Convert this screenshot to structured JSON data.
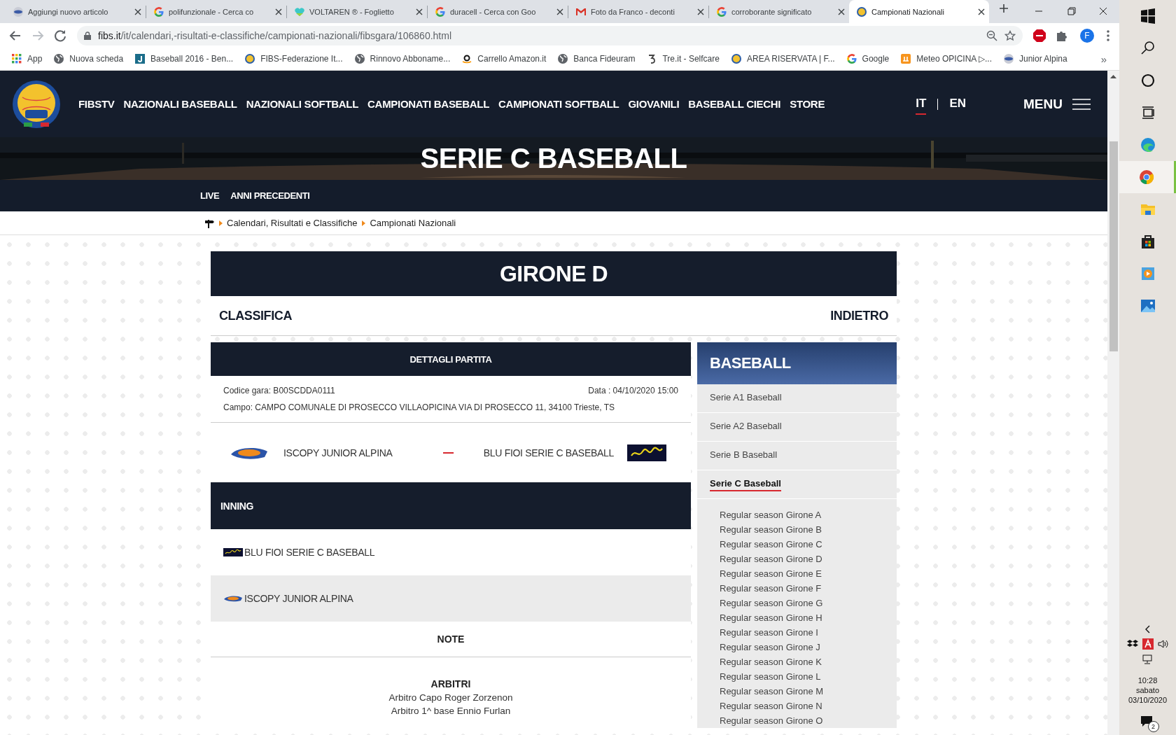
{
  "browser": {
    "tabs": [
      {
        "title": "Aggiungi nuovo articolo",
        "selected": false
      },
      {
        "title": "polifunzionale - Cerca co",
        "selected": false
      },
      {
        "title": "VOLTAREN ® - Foglietto",
        "selected": false
      },
      {
        "title": "duracell - Cerca con Goo",
        "selected": false
      },
      {
        "title": "Foto da Franco - deconti",
        "selected": false
      },
      {
        "title": "corroborante significato",
        "selected": false
      },
      {
        "title": "Campionati Nazionali",
        "selected": true
      }
    ],
    "address": {
      "domain": "fibs.it",
      "path": "/it/calendari,-risultati-e-classifiche/campionati-nazionali/fibsgara/106860.html"
    },
    "profile": "F",
    "bookmarks": [
      {
        "label": "App"
      },
      {
        "label": "Nuova scheda"
      },
      {
        "label": "Baseball 2016 - Ben..."
      },
      {
        "label": "FIBS-Federazione It..."
      },
      {
        "label": "Rinnovo Abboname..."
      },
      {
        "label": "Carrello Amazon.it"
      },
      {
        "label": "Banca Fideuram"
      },
      {
        "label": "Tre.it - Selfcare"
      },
      {
        "label": "AREA RISERVATA | F..."
      },
      {
        "label": "Google"
      },
      {
        "label": "Meteo OPICINA ▷..."
      },
      {
        "label": "Junior Alpina"
      }
    ],
    "more": "»"
  },
  "site": {
    "nav": [
      "FIBSTV",
      "NAZIONALI BASEBALL",
      "NAZIONALI SOFTBALL",
      "CAMPIONATI BASEBALL",
      "CAMPIONATI SOFTBALL",
      "GIOVANILI",
      "BASEBALL CIECHI",
      "STORE"
    ],
    "languages": [
      {
        "label": "IT",
        "selected": true
      },
      {
        "label": "EN",
        "selected": false
      }
    ],
    "menu": "MENU",
    "hero_title": "SERIE C BASEBALL",
    "subnav": [
      "LIVE",
      "ANNI PRECEDENTI"
    ],
    "breadcrumb": [
      "Calendari, Risultati e Classifiche",
      "Campionati Nazionali"
    ]
  },
  "group": {
    "title": "GIRONE D",
    "left_link": "CLASSIFICA",
    "right_link": "INDIETRO"
  },
  "match": {
    "header": "DETTAGLI PARTITA",
    "code": "Codice gara: B00SCDDA0111",
    "date": "Data : 04/10/2020 15:00",
    "venue": "Campo: CAMPO COMUNALE DI PROSECCO VILLAOPICINA VIA DI PROSECCO 11, 34100 Trieste, TS",
    "home": {
      "name": "ISCOPY JUNIOR ALPINA"
    },
    "away": {
      "name": "BLU FIOI SERIE C BASEBALL"
    }
  },
  "inning": {
    "header": "INNING",
    "rows": [
      {
        "team": "BLU FIOI SERIE C BASEBALL"
      },
      {
        "team": "ISCOPY JUNIOR ALPINA"
      }
    ]
  },
  "note": {
    "title": "NOTE"
  },
  "referees": {
    "title": "ARBITRI",
    "lines": [
      "Arbitro Capo Roger Zorzenon",
      "Arbitro 1^ base Ennio Furlan"
    ]
  },
  "sidebar": {
    "title": "BASEBALL",
    "items": [
      {
        "label": "Serie A1 Baseball",
        "selected": false
      },
      {
        "label": "Serie A2 Baseball",
        "selected": false
      },
      {
        "label": "Serie B Baseball",
        "selected": false
      },
      {
        "label": "Serie C Baseball",
        "selected": true
      }
    ],
    "sub_items": [
      "Regular season Girone A",
      "Regular season Girone B",
      "Regular season Girone C",
      "Regular season Girone D",
      "Regular season Girone E",
      "Regular season Girone F",
      "Regular season Girone G",
      "Regular season Girone H",
      "Regular season Girone I",
      "Regular season Girone J",
      "Regular season Girone K",
      "Regular season Girone L",
      "Regular season Girone M",
      "Regular season Girone N",
      "Regular season Girone O"
    ]
  },
  "taskbar": {
    "time": "10:28",
    "day": "sabato",
    "date": "03/10/2020",
    "notifications": "2"
  }
}
